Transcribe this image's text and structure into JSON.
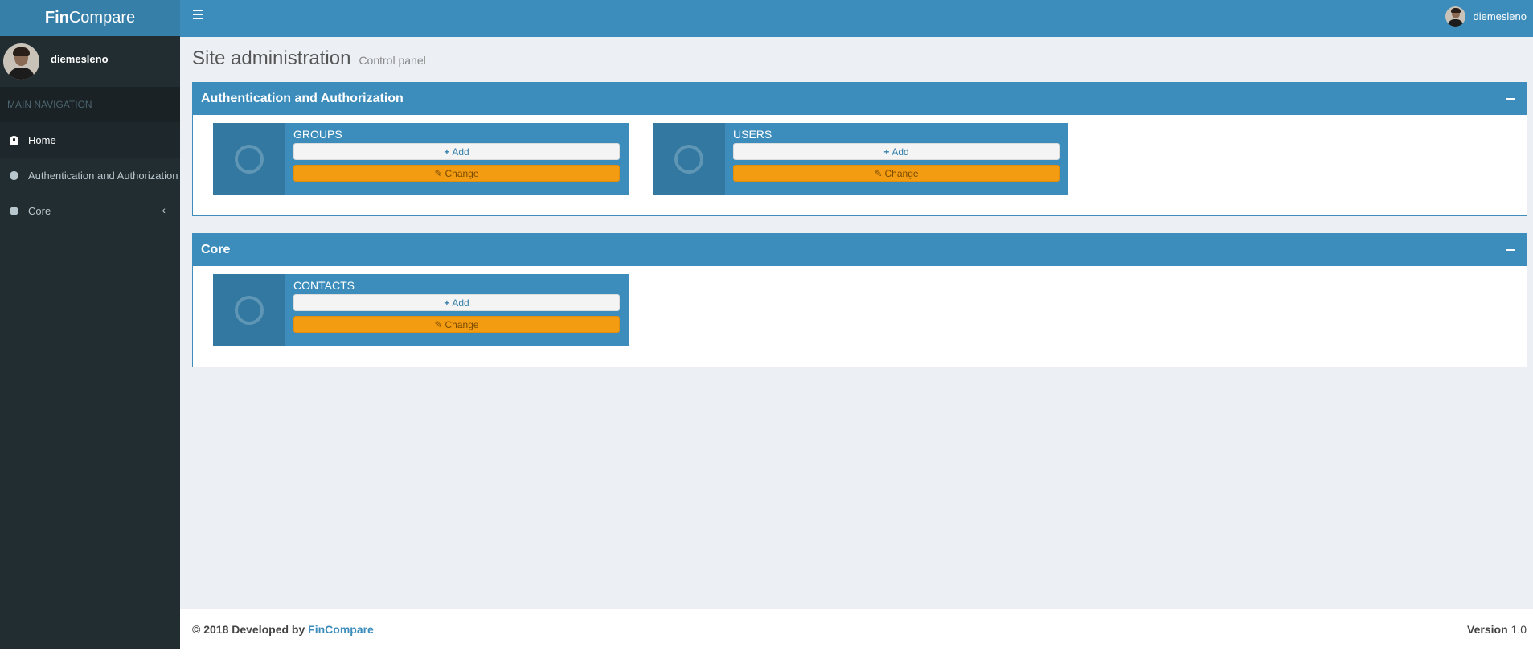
{
  "brand": {
    "bold": "Fin",
    "rest": "Compare"
  },
  "sidebar": {
    "user_name": "diemesleno",
    "nav_header": "MAIN NAVIGATION",
    "items": [
      {
        "label": "Home",
        "icon": "dashboard-icon"
      },
      {
        "label": "Authentication and Authorization",
        "icon": "circle-icon"
      },
      {
        "label": "Core",
        "icon": "circle-icon"
      }
    ]
  },
  "topbar": {
    "user_name": "diemesleno"
  },
  "page": {
    "title": "Site administration",
    "subtitle": "Control panel"
  },
  "sections": [
    {
      "title": "Authentication and Authorization",
      "models": [
        {
          "name": "GROUPS",
          "add_label": "Add",
          "change_label": "Change"
        },
        {
          "name": "USERS",
          "add_label": "Add",
          "change_label": "Change"
        }
      ]
    },
    {
      "title": "Core",
      "models": [
        {
          "name": "CONTACTS",
          "add_label": "Add",
          "change_label": "Change"
        }
      ]
    }
  ],
  "footer": {
    "copyright": "© 2018 Developed by",
    "company": "FinCompare",
    "version_label": "Version",
    "version": "1.0"
  },
  "colors": {
    "header": "#3c8dbc",
    "sidebar": "#222d32",
    "change_button": "#f39c12"
  }
}
